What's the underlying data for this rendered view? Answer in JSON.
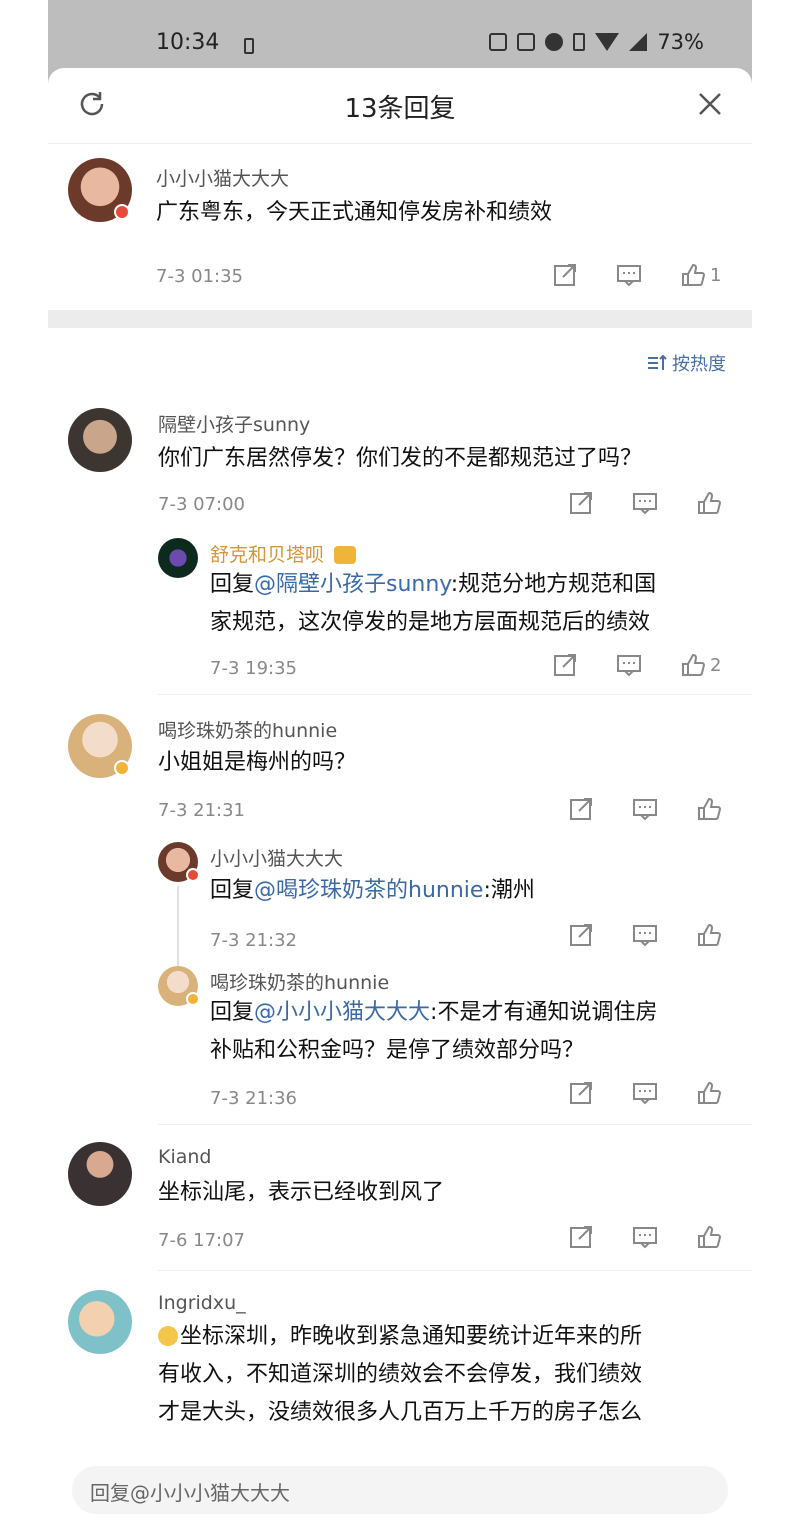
{
  "status_bar": {
    "time": "10:34",
    "battery": "73%"
  },
  "header": {
    "title": "13条回复"
  },
  "original_comment": {
    "username": "小小小猫大大大",
    "content": "广东粤东，今天正式通知停发房补和绩效",
    "time": "7-3 01:35",
    "likes": "1"
  },
  "sort": {
    "label": "按热度"
  },
  "comments": [
    {
      "username": "隔壁小孩子sunny",
      "content": "你们广东居然停发？你们发的不是都规范过了吗？",
      "time": "7-3 07:00",
      "replies": [
        {
          "username": "舒克和贝塔呗",
          "prefix": "回复",
          "mention": "@隔壁小孩子sunny",
          "content_line1": ":规范分地方规范和国",
          "content_line2": "家规范，这次停发的是地方层面规范后的绩效",
          "time": "7-3 19:35",
          "likes": "2"
        }
      ]
    },
    {
      "username": "喝珍珠奶茶的hunnie",
      "content": "小姐姐是梅州的吗？",
      "time": "7-3 21:31",
      "replies": [
        {
          "username": "小小小猫大大大",
          "prefix": "回复",
          "mention": "@喝珍珠奶茶的hunnie",
          "content": ":潮州",
          "time": "7-3 21:32"
        },
        {
          "username": "喝珍珠奶茶的hunnie",
          "prefix": "回复",
          "mention": "@小小小猫大大大",
          "content_line1": ":不是才有通知说调住房",
          "content_line2": "补贴和公积金吗？是停了绩效部分吗？",
          "time": "7-3 21:36"
        }
      ]
    },
    {
      "username": "Kiand",
      "content": "坐标汕尾，表示已经收到风了",
      "time": "7-6 17:07"
    },
    {
      "username": "Ingridxu_",
      "content_line1": "坐标深圳，昨晚收到紧急通知要统计近年来的所",
      "content_line2": "有收入，不知道深圳的绩效会不会停发，我们绩效",
      "content_line3": "才是大头，没绩效很多人几百万上千万的房子怎么"
    }
  ],
  "reply_bar": {
    "placeholder": "回复@小小小猫大大大"
  },
  "colors": {
    "link": "#3a6aa6",
    "vip_name": "#d3953a",
    "muted": "#888888"
  }
}
